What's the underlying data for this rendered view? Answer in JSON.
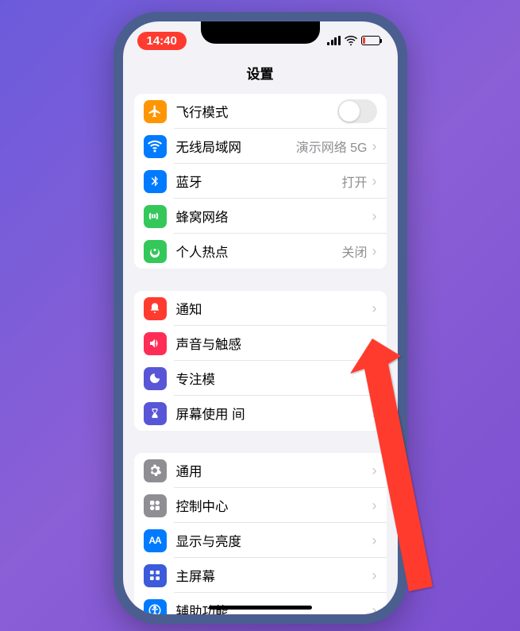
{
  "status": {
    "time": "14:40"
  },
  "header": {
    "title": "设置"
  },
  "groups": [
    {
      "rows": [
        {
          "icon": "airplane",
          "bg": "#ff9500",
          "label": "飞行模式",
          "toggle": true
        },
        {
          "icon": "wifi",
          "bg": "#007aff",
          "label": "无线局域网",
          "value": "演示网络 5G"
        },
        {
          "icon": "bluetooth",
          "bg": "#007aff",
          "label": "蓝牙",
          "value": "打开"
        },
        {
          "icon": "cellular",
          "bg": "#34c759",
          "label": "蜂窝网络",
          "value": ""
        },
        {
          "icon": "hotspot",
          "bg": "#34c759",
          "label": "个人热点",
          "value": "关闭"
        }
      ]
    },
    {
      "rows": [
        {
          "icon": "bell",
          "bg": "#ff3b30",
          "label": "通知",
          "value": ""
        },
        {
          "icon": "speaker",
          "bg": "#ff2d55",
          "label": "声音与触感",
          "value": ""
        },
        {
          "icon": "moon",
          "bg": "#5856d6",
          "label": "专注模",
          "value": ""
        },
        {
          "icon": "hourglass",
          "bg": "#5856d6",
          "label": "屏幕使用    间",
          "value": ""
        }
      ]
    },
    {
      "rows": [
        {
          "icon": "gear",
          "bg": "#8e8e93",
          "label": "通用",
          "value": ""
        },
        {
          "icon": "control",
          "bg": "#8e8e93",
          "label": "控制中心",
          "value": ""
        },
        {
          "icon": "display",
          "bg": "#007aff",
          "label": "显示与亮度",
          "value": ""
        },
        {
          "icon": "home",
          "bg": "#3b5bdb",
          "label": "主屏幕",
          "value": ""
        },
        {
          "icon": "accessibility",
          "bg": "#007aff",
          "label": "辅助功能",
          "value": ""
        }
      ]
    }
  ]
}
